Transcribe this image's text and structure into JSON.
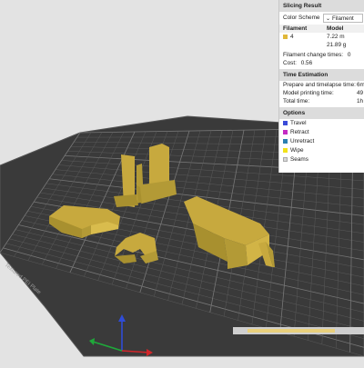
{
  "panel": {
    "title": "Slicing Result",
    "color_scheme_label": "Color Scheme",
    "color_scheme_value": "Filament",
    "col_filament": "Filament",
    "col_model": "Model",
    "filament_id": "4",
    "filament_color": "#e0b83a",
    "model_length": "7.22 m",
    "model_weight": "21.89 g",
    "change_times": "Filament change times:",
    "change_times_value": "0",
    "cost_label": "Cost:",
    "cost_value": "0.56",
    "time_title": "Time Estimation",
    "prepare_time": "Prepare and timelapse time:",
    "prepare_value": "6m",
    "model_time": "Model printing time:",
    "model_time_value": "49",
    "total_time": "Total time:",
    "total_time_value": "1h",
    "options_title": "Options",
    "options": [
      {
        "label": "Travel",
        "color": "#3b4bd8"
      },
      {
        "label": "Retract",
        "color": "#c42bc4"
      },
      {
        "label": "Unretract",
        "color": "#2a7fb0"
      },
      {
        "label": "Wipe",
        "color": "#f2e21a"
      },
      {
        "label": "Seams",
        "color": "#d8d8d8"
      }
    ]
  },
  "plate": {
    "label": "Textured PEI Plate",
    "bed_color": "#3a3a3a",
    "grid_color": "#6e6e6e",
    "model_color": "#c7a93e"
  }
}
